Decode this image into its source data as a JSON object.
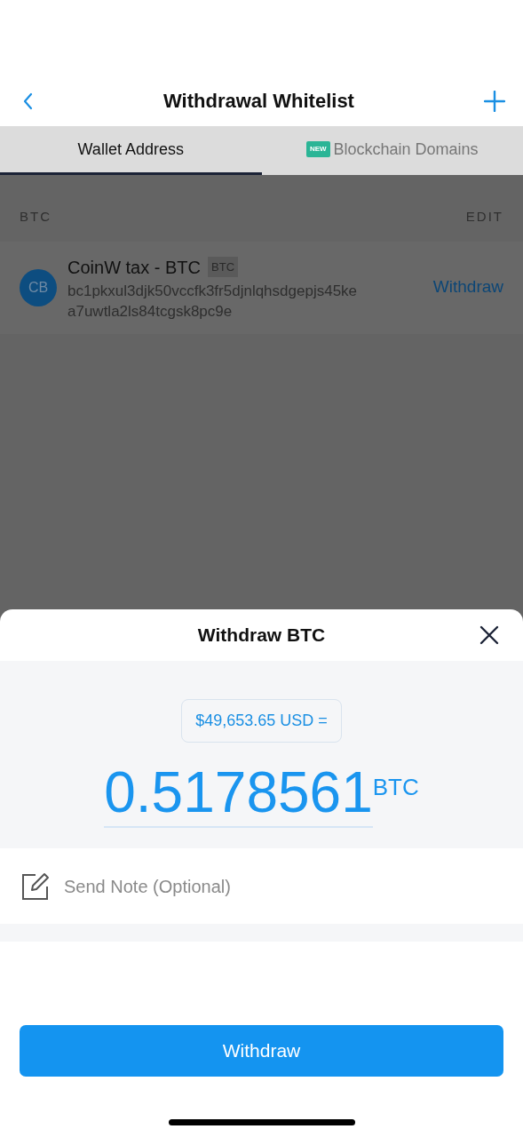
{
  "nav": {
    "title": "Withdrawal Whitelist"
  },
  "tabs": [
    {
      "label": "Wallet Address",
      "selected": true
    },
    {
      "label": "Blockchain Domains",
      "selected": false,
      "badge": "NEW"
    }
  ],
  "section": {
    "title": "BTC",
    "action": "EDIT"
  },
  "addresses": [
    {
      "initials": "CB",
      "name": "CoinW tax - BTC",
      "tag": "BTC",
      "address": "bc1pkxul3djk50vccfk3fr5djnlqhsdgepjs45ke a7uwtla2ls84tcgsk8pc9e",
      "action": "Withdraw"
    }
  ],
  "sheet": {
    "title": "Withdraw BTC",
    "fiat": "$49,653.65 USD =",
    "amount": "0.5178561",
    "unit": "BTC",
    "note_placeholder": "Send Note (Optional)",
    "button": "Withdraw"
  }
}
